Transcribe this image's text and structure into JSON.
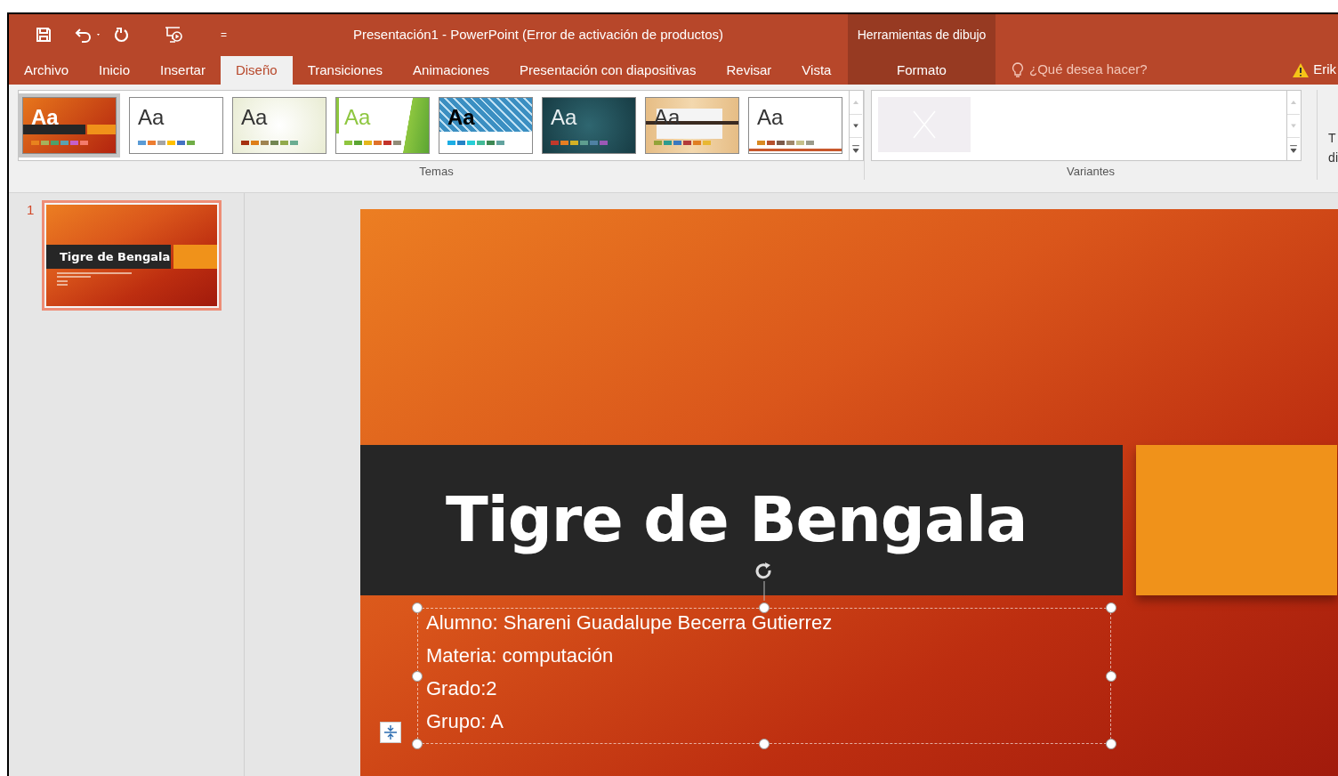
{
  "window": {
    "title": "Presentación1 - PowerPoint (Error de activación de productos)"
  },
  "quick_access": {
    "customize": "="
  },
  "contextual_group": {
    "title": "Herramientas de dibujo",
    "tab": {
      "label": "Formato",
      "selected": false
    }
  },
  "tabs": [
    {
      "label": "Archivo",
      "selected": false
    },
    {
      "label": "Inicio",
      "selected": false
    },
    {
      "label": "Insertar",
      "selected": false
    },
    {
      "label": "Diseño",
      "selected": true
    },
    {
      "label": "Transiciones",
      "selected": false
    },
    {
      "label": "Animaciones",
      "selected": false
    },
    {
      "label": "Presentación con diapositivas",
      "selected": false
    },
    {
      "label": "Revisar",
      "selected": false
    },
    {
      "label": "Vista",
      "selected": false
    }
  ],
  "tell_me": {
    "placeholder": "¿Qué desea hacer?"
  },
  "user": {
    "name": "Erik"
  },
  "themes": {
    "label": "Temas",
    "items": [
      {
        "label": "Aa",
        "kind": "orange",
        "selected": true,
        "swatches": [
          {
            "color": "#e8821e"
          },
          {
            "color": "#a5b25c"
          },
          {
            "color": "#4fa06a"
          },
          {
            "color": "#5aa2ae"
          },
          {
            "color": "#c560c9"
          },
          {
            "color": "#f47b6b"
          }
        ]
      },
      {
        "label": "Aa",
        "kind": "white",
        "selected": false,
        "swatches": [
          {
            "color": "#5b9bd5"
          },
          {
            "color": "#ed7d31"
          },
          {
            "color": "#a5a5a5"
          },
          {
            "color": "#ffc000"
          },
          {
            "color": "#4472c4"
          },
          {
            "color": "#70ad47"
          }
        ]
      },
      {
        "label": "Aa",
        "kind": "ivory",
        "selected": false,
        "swatches": [
          {
            "color": "#a53010"
          },
          {
            "color": "#de7e18"
          },
          {
            "color": "#9f8351"
          },
          {
            "color": "#728653"
          },
          {
            "color": "#92aa4c"
          },
          {
            "color": "#6aac91"
          }
        ]
      },
      {
        "label": "Aa",
        "kind": "green",
        "selected": false,
        "swatches": [
          {
            "color": "#8fc53f"
          },
          {
            "color": "#5ba533"
          },
          {
            "color": "#e4b71b"
          },
          {
            "color": "#e0712a"
          },
          {
            "color": "#c4322a"
          },
          {
            "color": "#928c78"
          }
        ]
      },
      {
        "label": "Aa",
        "kind": "pattern",
        "selected": false,
        "swatches": [
          {
            "color": "#1cade4"
          },
          {
            "color": "#2683c6"
          },
          {
            "color": "#27ced7"
          },
          {
            "color": "#42ba97"
          },
          {
            "color": "#3e8853"
          },
          {
            "color": "#62a39f"
          }
        ]
      },
      {
        "label": "Aa",
        "kind": "teal",
        "selected": false,
        "swatches": [
          {
            "color": "#c0392b"
          },
          {
            "color": "#e67e22"
          },
          {
            "color": "#d4b125"
          },
          {
            "color": "#5e9e8f"
          },
          {
            "color": "#4f81a3"
          },
          {
            "color": "#9b59b6"
          }
        ]
      },
      {
        "label": "Aa",
        "kind": "wood",
        "selected": false,
        "swatches": [
          {
            "color": "#93a339"
          },
          {
            "color": "#2e9b8e"
          },
          {
            "color": "#3b79bf"
          },
          {
            "color": "#b33a3a"
          },
          {
            "color": "#e07e22"
          },
          {
            "color": "#e8b732"
          }
        ]
      },
      {
        "label": "Aa",
        "kind": "plain",
        "selected": false,
        "swatches": [
          {
            "color": "#d98a23"
          },
          {
            "color": "#b5502d"
          },
          {
            "color": "#7c5a4a"
          },
          {
            "color": "#a0886b"
          },
          {
            "color": "#c6c08a"
          },
          {
            "color": "#9b9b8b"
          }
        ]
      }
    ]
  },
  "variants": {
    "label": "Variantes"
  },
  "cut_group_label": [
    "T",
    "di"
  ],
  "slides": [
    {
      "number": "1",
      "title": "Tigre de Bengala",
      "selected": true
    }
  ],
  "slide": {
    "title": "Tigre de Bengala",
    "subtitle_lines": [
      "Alumno: Shareni Guadalupe Becerra Gutierrez",
      "Materia: computación",
      "Grado:2",
      "Grupo: A"
    ]
  }
}
